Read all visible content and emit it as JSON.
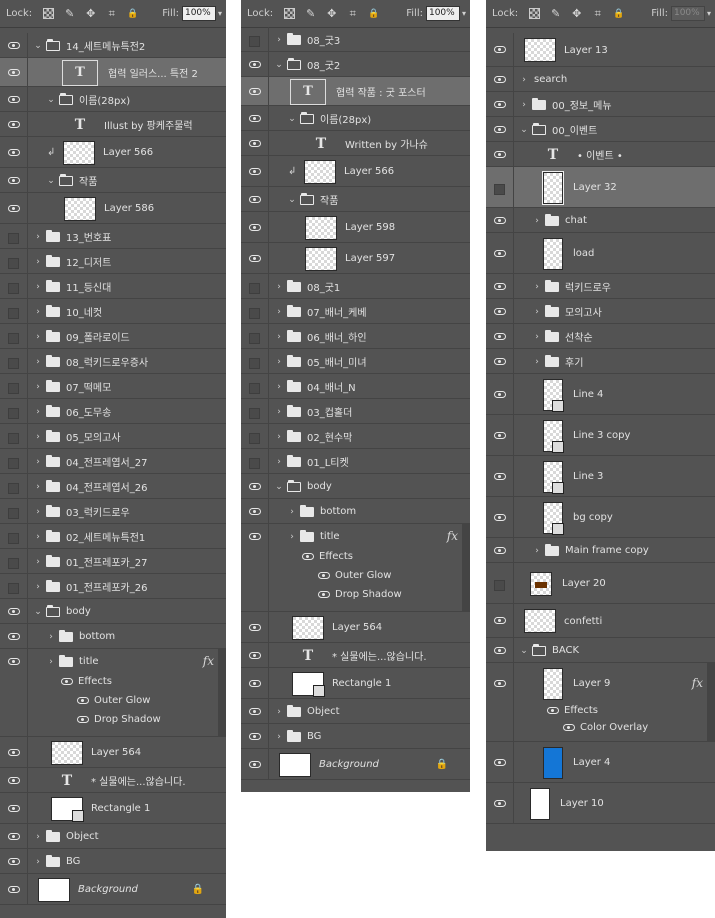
{
  "colors": {
    "panel": "#535353",
    "row_border": "#444444",
    "selected": "#6e6e6e",
    "blue_swatch": "#1476d6",
    "brown_swatch": "#6b3200"
  },
  "panel1": {
    "lock_label": "Lock:",
    "fill_label": "Fill:",
    "fill_value": "100%",
    "rows": [
      {
        "name": "14_세트메뉴특전2",
        "kind": "group",
        "open": true,
        "indent": 0,
        "eye": true
      },
      {
        "name": "협력 일러스... 특전 2",
        "kind": "textbox",
        "indent": 2,
        "eye": true,
        "selected": true
      },
      {
        "name": "이름(28px)",
        "kind": "group",
        "open": true,
        "indent": 1,
        "eye": true
      },
      {
        "name": "Illust by 팡케주물럭",
        "kind": "text",
        "indent": 2,
        "eye": true
      },
      {
        "name": "Layer 566",
        "kind": "pixel",
        "clip": true,
        "indent": 1,
        "eye": true
      },
      {
        "name": "작품",
        "kind": "group",
        "open": true,
        "indent": 1,
        "eye": true
      },
      {
        "name": "Layer 586",
        "kind": "pixel",
        "indent": 2,
        "eye": true
      },
      {
        "name": "13_번호표",
        "kind": "group",
        "indent": 0,
        "eye": false
      },
      {
        "name": "12_디저트",
        "kind": "group",
        "indent": 0,
        "eye": false
      },
      {
        "name": "11_등신대",
        "kind": "group",
        "indent": 0,
        "eye": false
      },
      {
        "name": "10_네컷",
        "kind": "group",
        "indent": 0,
        "eye": false
      },
      {
        "name": "09_폴라로이드",
        "kind": "group",
        "indent": 0,
        "eye": false
      },
      {
        "name": "08_럭키드로우증사",
        "kind": "group",
        "indent": 0,
        "eye": false
      },
      {
        "name": "07_떡메모",
        "kind": "group",
        "indent": 0,
        "eye": false
      },
      {
        "name": "06_도무송",
        "kind": "group",
        "indent": 0,
        "eye": false
      },
      {
        "name": "05_모의고사",
        "kind": "group",
        "indent": 0,
        "eye": false
      },
      {
        "name": "04_전프레엽서_27",
        "kind": "group",
        "indent": 0,
        "eye": false
      },
      {
        "name": "04_전프레엽서_26",
        "kind": "group",
        "indent": 0,
        "eye": false
      },
      {
        "name": "03_럭키드로우",
        "kind": "group",
        "indent": 0,
        "eye": false
      },
      {
        "name": "02_세트메뉴특전1",
        "kind": "group",
        "indent": 0,
        "eye": false
      },
      {
        "name": "01_전프레포카_27",
        "kind": "group",
        "indent": 0,
        "eye": false
      },
      {
        "name": "01_전프레포카_26",
        "kind": "group",
        "indent": 0,
        "eye": false
      },
      {
        "name": "body",
        "kind": "group",
        "open": true,
        "indent": 0,
        "eye": true
      },
      {
        "name": "bottom",
        "kind": "group",
        "indent": 1,
        "eye": true
      },
      {
        "name": "title",
        "kind": "group",
        "indent": 1,
        "eye": true,
        "fx": "fx",
        "effects": [
          "Effects",
          "Outer Glow",
          "Drop Shadow"
        ]
      },
      {
        "name": "Layer 564",
        "kind": "pixel",
        "indent": 1,
        "eye": true
      },
      {
        "name": "* 실물에는...않습니다.",
        "kind": "text",
        "indent": 1,
        "eye": true
      },
      {
        "name": "Rectangle 1",
        "kind": "shape",
        "indent": 1,
        "eye": true
      },
      {
        "name": "Object",
        "kind": "group",
        "indent": 0,
        "eye": true
      },
      {
        "name": "BG",
        "kind": "group",
        "indent": 0,
        "eye": true
      },
      {
        "name": "Background",
        "kind": "bg",
        "indent": 0,
        "eye": true,
        "italic": true,
        "locked": true
      }
    ]
  },
  "panel2": {
    "lock_label": "Lock:",
    "fill_label": "Fill:",
    "fill_value": "100%",
    "rows": [
      {
        "name": "08_굿3",
        "kind": "group",
        "indent": 0,
        "eye": false
      },
      {
        "name": "08_굿2",
        "kind": "group",
        "open": true,
        "indent": 0,
        "eye": true
      },
      {
        "name": "협력 작품 : 굿 포스터",
        "kind": "textbox",
        "indent": 1,
        "eye": true,
        "selected": true
      },
      {
        "name": "이름(28px)",
        "kind": "group",
        "open": true,
        "indent": 1,
        "eye": true
      },
      {
        "name": "Written by 가나슈",
        "kind": "text",
        "indent": 2,
        "eye": true
      },
      {
        "name": "Layer 566",
        "kind": "pixel",
        "clip": true,
        "indent": 1,
        "eye": true
      },
      {
        "name": "작품",
        "kind": "group",
        "open": true,
        "indent": 1,
        "eye": true
      },
      {
        "name": "Layer 598",
        "kind": "pixel",
        "indent": 2,
        "eye": true
      },
      {
        "name": "Layer 597",
        "kind": "pixel",
        "indent": 2,
        "eye": true
      },
      {
        "name": "08_굿1",
        "kind": "group",
        "indent": 0,
        "eye": false
      },
      {
        "name": "07_배너_케베",
        "kind": "group",
        "indent": 0,
        "eye": false
      },
      {
        "name": "06_배너_하인",
        "kind": "group",
        "indent": 0,
        "eye": false
      },
      {
        "name": "05_배너_미녀",
        "kind": "group",
        "indent": 0,
        "eye": false
      },
      {
        "name": "04_배너_N",
        "kind": "group",
        "indent": 0,
        "eye": false
      },
      {
        "name": "03_컵홀더",
        "kind": "group",
        "indent": 0,
        "eye": false
      },
      {
        "name": "02_현수막",
        "kind": "group",
        "indent": 0,
        "eye": false
      },
      {
        "name": "01_L티켓",
        "kind": "group",
        "indent": 0,
        "eye": false
      },
      {
        "name": "body",
        "kind": "group",
        "open": true,
        "indent": 0,
        "eye": true
      },
      {
        "name": "bottom",
        "kind": "group",
        "indent": 1,
        "eye": true
      },
      {
        "name": "title",
        "kind": "group",
        "indent": 1,
        "eye": true,
        "fx": "fx",
        "effects": [
          "Effects",
          "Outer Glow",
          "Drop Shadow"
        ]
      },
      {
        "name": "Layer 564",
        "kind": "pixel",
        "indent": 1,
        "eye": true
      },
      {
        "name": "* 실물에는...않습니다.",
        "kind": "text",
        "indent": 1,
        "eye": true
      },
      {
        "name": "Rectangle 1",
        "kind": "shape",
        "indent": 1,
        "eye": true
      },
      {
        "name": "Object",
        "kind": "group",
        "indent": 0,
        "eye": true
      },
      {
        "name": "BG",
        "kind": "group",
        "indent": 0,
        "eye": true
      },
      {
        "name": "Background",
        "kind": "bg",
        "indent": 0,
        "eye": true,
        "italic": true,
        "locked": true
      }
    ]
  },
  "panel3": {
    "lock_label": "Lock:",
    "fill_label": "Fill:",
    "fill_value": "100%",
    "rows": [
      {
        "name": "Layer 13",
        "kind": "pixel",
        "indent": 0,
        "eye": true
      },
      {
        "name": "search",
        "kind": "group",
        "indent": 0,
        "eye": true,
        "nofolder": true
      },
      {
        "name": "00_정보_메뉴",
        "kind": "group",
        "indent": 0,
        "eye": true
      },
      {
        "name": "00_이벤트",
        "kind": "group",
        "open": true,
        "indent": 0,
        "eye": true
      },
      {
        "name": "• 이벤트 •",
        "kind": "text",
        "indent": 1,
        "eye": true
      },
      {
        "name": "Layer 32",
        "kind": "tallsel",
        "indent": 1,
        "eye": false,
        "selected": true
      },
      {
        "name": "chat",
        "kind": "group",
        "indent": 1,
        "eye": true
      },
      {
        "name": "load",
        "kind": "tall",
        "indent": 1,
        "eye": true
      },
      {
        "name": "럭키드로우",
        "kind": "group",
        "indent": 1,
        "eye": true
      },
      {
        "name": "모의고사",
        "kind": "group",
        "indent": 1,
        "eye": true
      },
      {
        "name": "선착순",
        "kind": "group",
        "indent": 1,
        "eye": true
      },
      {
        "name": "후기",
        "kind": "group",
        "indent": 1,
        "eye": true
      },
      {
        "name": "Line 4",
        "kind": "tallmask",
        "indent": 1,
        "eye": true
      },
      {
        "name": "Line 3 copy",
        "kind": "tallmask",
        "indent": 1,
        "eye": true
      },
      {
        "name": "Line 3",
        "kind": "tallmask",
        "indent": 1,
        "eye": true
      },
      {
        "name": "bg copy",
        "kind": "tallmask",
        "indent": 1,
        "eye": true
      },
      {
        "name": "Main frame copy",
        "kind": "group",
        "indent": 1,
        "eye": true
      },
      {
        "name": "Layer 20",
        "kind": "brown",
        "indent": 0,
        "eye": false
      },
      {
        "name": "confetti",
        "kind": "pixel",
        "indent": 0,
        "eye": true
      },
      {
        "name": "BACK",
        "kind": "group",
        "open": true,
        "indent": 0,
        "eye": true
      },
      {
        "name": "Layer 9",
        "kind": "tall",
        "indent": 1,
        "eye": true,
        "fx": "fx",
        "effects": [
          "Effects",
          "Color Overlay"
        ]
      },
      {
        "name": "Layer 4",
        "kind": "tallblue",
        "indent": 1,
        "eye": true
      },
      {
        "name": "Layer 10",
        "kind": "tallwhite",
        "indent": 0,
        "eye": true
      }
    ]
  }
}
